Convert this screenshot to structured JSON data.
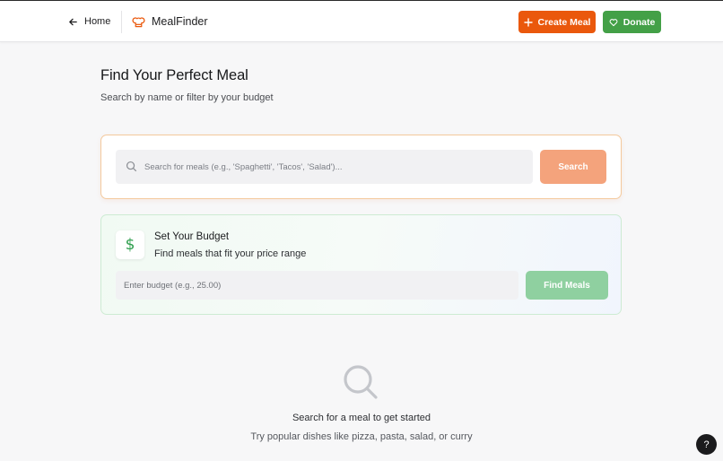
{
  "header": {
    "home_label": "Home",
    "brand_name": "MealFinder",
    "create_label": "Create Meal",
    "donate_label": "Donate"
  },
  "page": {
    "title": "Find Your Perfect Meal",
    "subtitle": "Search by name or filter by your budget"
  },
  "search": {
    "placeholder": "Search for meals (e.g., 'Spaghetti', 'Tacos', 'Salad')...",
    "value": "",
    "button_label": "Search"
  },
  "budget": {
    "icon_glyph": "$",
    "title": "Set Your Budget",
    "subtitle": "Find meals that fit your price range",
    "placeholder": "Enter budget (e.g., 25.00)",
    "value": "",
    "button_label": "Find Meals"
  },
  "empty_state": {
    "title": "Search for a meal to get started",
    "subtitle": "Try popular dishes like pizza, pasta, salad, or curry"
  },
  "help": {
    "label": "?"
  },
  "icons": {
    "back": "arrow-left-icon",
    "brand": "chef-hat-icon",
    "create": "plus-icon",
    "donate": "heart-icon",
    "search": "search-icon",
    "budget": "dollar-icon",
    "empty": "magnifier-icon"
  },
  "colors": {
    "brand_orange": "#ea580c",
    "donate_green": "#43a047",
    "search_button": "#f4a37c",
    "find_button": "#8fd0a0",
    "budget_icon": "#2e9e4d"
  }
}
